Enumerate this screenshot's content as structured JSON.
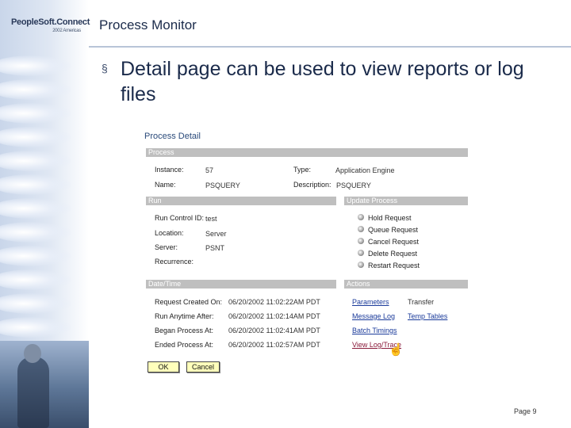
{
  "header": {
    "logo_text": "PeopleSoft.Connect",
    "logo_sub": "2002 Americas",
    "title": "Process Monitor"
  },
  "bullet": {
    "text": "Detail page can be used to view reports or log files"
  },
  "panel": {
    "title": "Process Detail",
    "process": {
      "header": "Process",
      "instance_label": "Instance:",
      "instance_value": "57",
      "type_label": "Type:",
      "type_value": "Application Engine",
      "name_label": "Name:",
      "name_value": "PSQUERY",
      "description_label": "Description:",
      "description_value": "PSQUERY"
    },
    "run": {
      "header": "Run",
      "run_control_label": "Run Control ID:",
      "run_control_value": "test",
      "location_label": "Location:",
      "location_value": "Server",
      "server_label": "Server:",
      "server_value": "PSNT",
      "recurrence_label": "Recurrence:"
    },
    "update_process": {
      "header": "Update Process",
      "options": [
        "Hold Request",
        "Queue Request",
        "Cancel Request",
        "Delete Request",
        "Restart Request"
      ]
    },
    "date_time": {
      "header": "Date/Time",
      "rows": [
        {
          "label": "Request Created On:",
          "value": "06/20/2002 11:02:22AM PDT"
        },
        {
          "label": "Run Anytime After:",
          "value": "06/20/2002 11:02:14AM PDT"
        },
        {
          "label": "Began Process At:",
          "value": "06/20/2002 11:02:41AM PDT"
        },
        {
          "label": "Ended Process At:",
          "value": "06/20/2002 11:02:57AM PDT"
        }
      ]
    },
    "actions": {
      "header": "Actions",
      "parameters": "Parameters",
      "transfer": "Transfer",
      "message_log": "Message Log",
      "temp_tables": "Temp Tables",
      "batch_timings": "Batch Timings",
      "view_log_trace": "View Log/Trace"
    },
    "buttons": {
      "ok": "OK",
      "cancel": "Cancel"
    }
  },
  "footer": {
    "page": "Page 9"
  }
}
